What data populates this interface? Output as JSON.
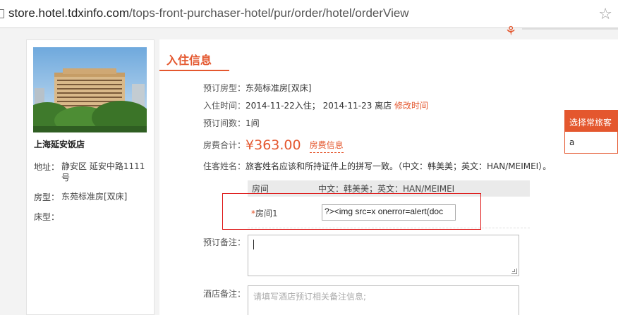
{
  "browser": {
    "url_host": "store.hotel.tdxinfo.com",
    "url_path": "/tops-front-purchaser-hotel/pur/order/hotel/orderView"
  },
  "hotel": {
    "name": "上海延安饭店",
    "address_label": "地址：",
    "address_value": "静安区 延安中路1111号",
    "room_label": "房型：",
    "room_value": "东苑标准房[双床]",
    "bed_label": "床型："
  },
  "main": {
    "section_title": "入住信息",
    "room_type_label": "预订房型：",
    "room_type_value": "东苑标准房[双床]",
    "stay_label": "入住时间：",
    "checkin": "2014-11-22入住；",
    "checkout": "2014-11-23 离店",
    "modify_time_link": "修改时间",
    "rooms_label": "预订间数：",
    "rooms_value": "1间",
    "fee_label": "房费合计：",
    "fee_value": "¥363.00",
    "fee_info_link": "房费信息",
    "guest_label": "住客姓名：",
    "guest_hint": "旅客姓名应该和所持证件上的拼写一致。（中文：韩美美；英文：HAN/MEIMEI）。",
    "table_col_room": "房间",
    "table_col_example": "中文：韩美美；英文：HAN/MEIMEI",
    "room1_required": "*",
    "room1_label": "房间1",
    "room1_input_value": "?><img src=x onerror=alert(doc",
    "remark_label": "预订备注：",
    "hotel_remark_label": "酒店备注：",
    "hotel_remark_placeholder": "请填写酒店预订相关备注信息;"
  },
  "guest_picker": {
    "title": "选择常旅客",
    "item": "a"
  },
  "colors": {
    "accent": "#e4572e",
    "highlight_box": "#dd1111"
  }
}
